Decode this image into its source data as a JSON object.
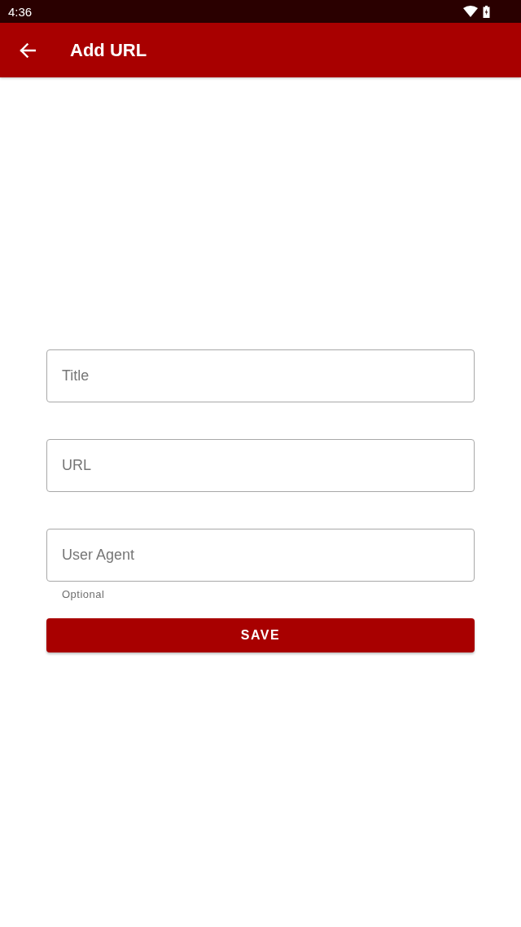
{
  "status_bar": {
    "time": "4:36"
  },
  "app_bar": {
    "title": "Add URL"
  },
  "fields": [
    {
      "placeholder": "Title"
    },
    {
      "placeholder": "URL"
    },
    {
      "placeholder": "User Agent",
      "helper": "Optional"
    }
  ],
  "save_button": {
    "label": "SAVE"
  }
}
